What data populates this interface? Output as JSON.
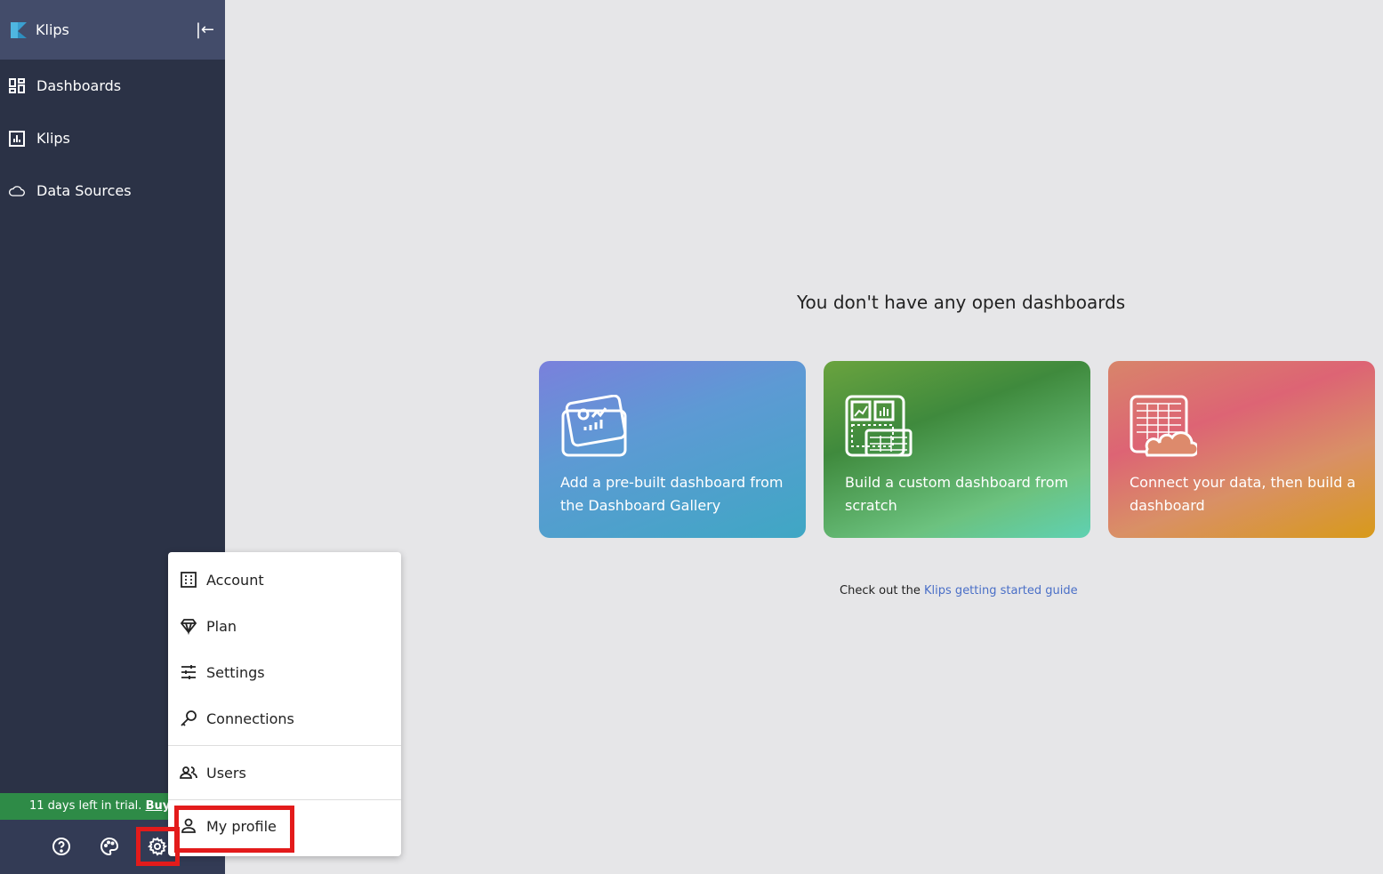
{
  "app": {
    "name": "Klips"
  },
  "sidebar": {
    "items": [
      {
        "label": "Dashboards",
        "icon": "dashboard-grid-icon"
      },
      {
        "label": "Klips",
        "icon": "bar-chart-icon"
      },
      {
        "label": "Data Sources",
        "icon": "cloud-icon"
      }
    ]
  },
  "trial": {
    "text": "11 days left in trial.",
    "link": "Buy now"
  },
  "main": {
    "title": "You don't have any open dashboards",
    "cards": [
      {
        "text": "Add a pre-built dashboard from the Dashboard Gallery"
      },
      {
        "text": "Build a custom dashboard from scratch"
      },
      {
        "text": "Connect your data, then build a dashboard"
      }
    ],
    "guide_prefix": "Check out the",
    "guide_link": "Klips getting started guide"
  },
  "menu": {
    "items": [
      {
        "label": "Account"
      },
      {
        "label": "Plan"
      },
      {
        "label": "Settings"
      },
      {
        "label": "Connections"
      },
      {
        "label": "Users"
      },
      {
        "label": "My profile"
      }
    ]
  },
  "colors": {
    "highlight": "#e31b1b",
    "trial": "#2e8b47",
    "link": "#4a6fc7"
  }
}
